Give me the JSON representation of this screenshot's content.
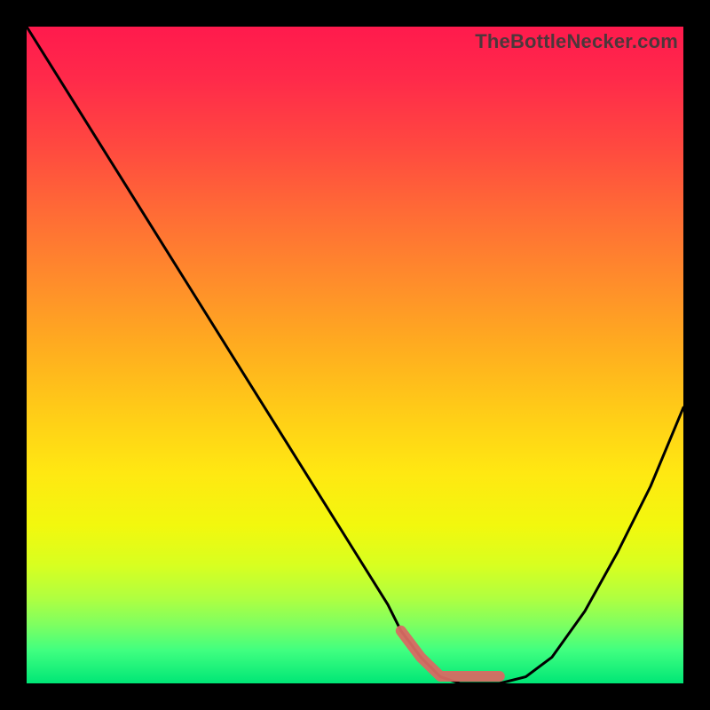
{
  "watermark": {
    "text": "TheBottleNecker.com"
  },
  "chart_data": {
    "type": "line",
    "title": "",
    "xlabel": "",
    "ylabel": "",
    "xlim": [
      0,
      100
    ],
    "ylim": [
      0,
      100
    ],
    "x": [
      0,
      5,
      10,
      15,
      20,
      25,
      30,
      35,
      40,
      45,
      50,
      55,
      57,
      60,
      63,
      66,
      68,
      72,
      76,
      80,
      85,
      90,
      95,
      100
    ],
    "y": [
      100,
      92,
      84,
      76,
      68,
      60,
      52,
      44,
      36,
      28,
      20,
      12,
      8,
      4,
      1,
      0,
      0,
      0,
      1,
      4,
      11,
      20,
      30,
      42
    ],
    "highlight_range_x": [
      57,
      75
    ],
    "series": [
      {
        "name": "curve",
        "color": "#000000"
      }
    ],
    "background_gradient": {
      "top": "#ff1a4d",
      "mid": "#ffdc10",
      "bottom": "#00e676"
    },
    "highlight_color": "#d86a63"
  }
}
